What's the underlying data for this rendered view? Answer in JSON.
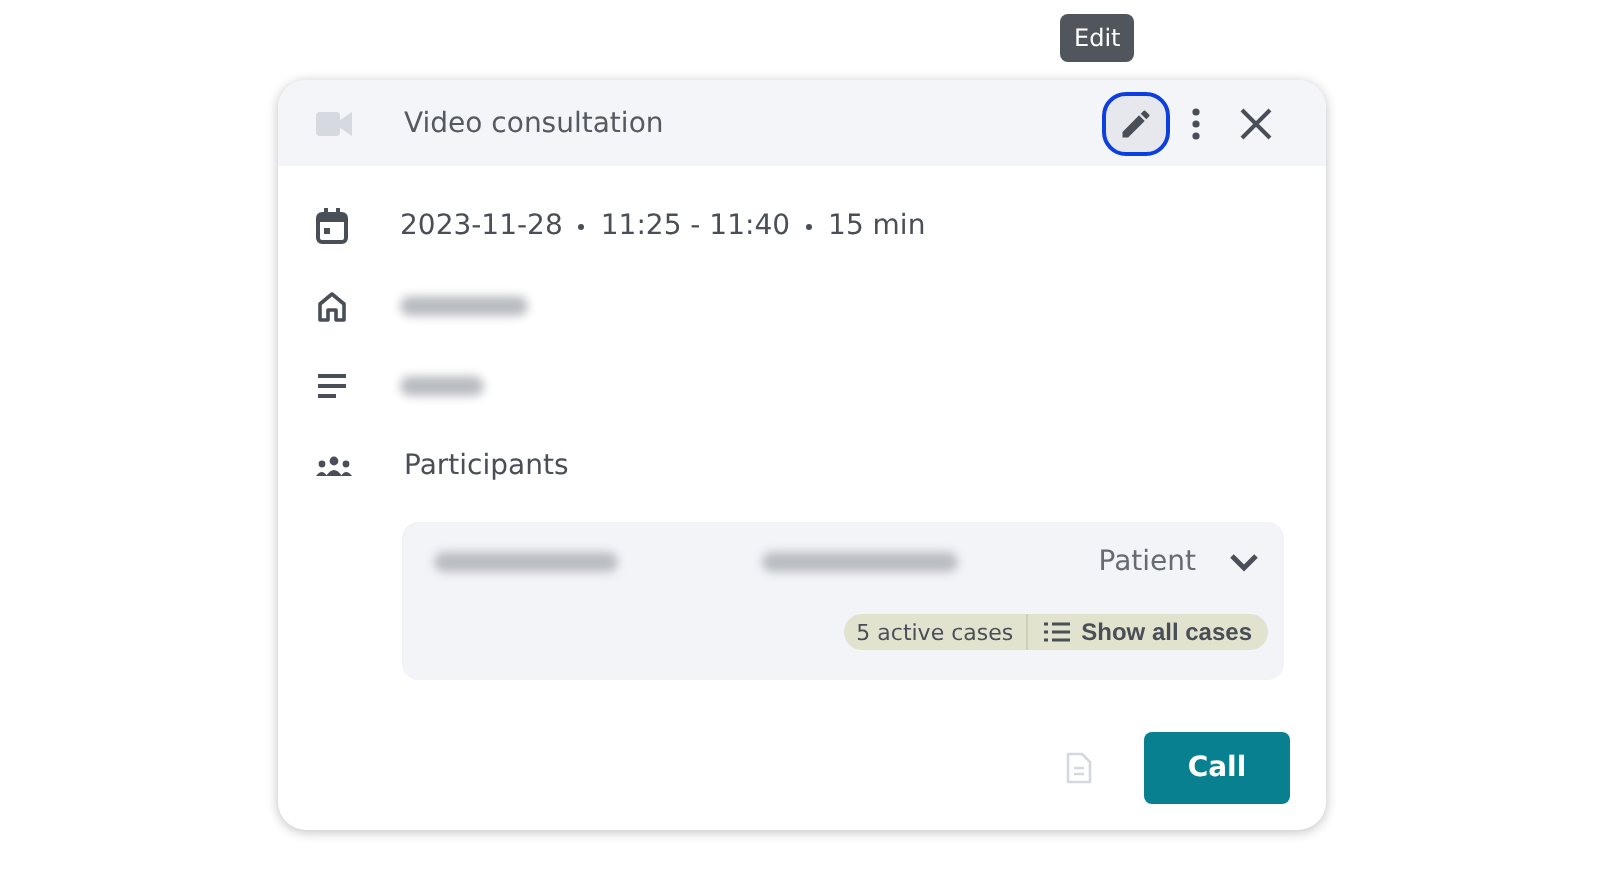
{
  "tooltip": {
    "text": "Edit"
  },
  "header": {
    "title": "Video consultation",
    "edit_focused": true
  },
  "details": {
    "date": "2023-11-28",
    "time": "11:25 - 11:40",
    "duration": "15 min",
    "location_redacted": true,
    "description_redacted": true
  },
  "participants": {
    "label": "Participants",
    "items": [
      {
        "role": "Patient",
        "expanded": false,
        "active_cases": "5 active cases",
        "show_cases": "Show all cases"
      }
    ]
  },
  "footer": {
    "note_disabled": true,
    "call_button": "Call"
  }
}
